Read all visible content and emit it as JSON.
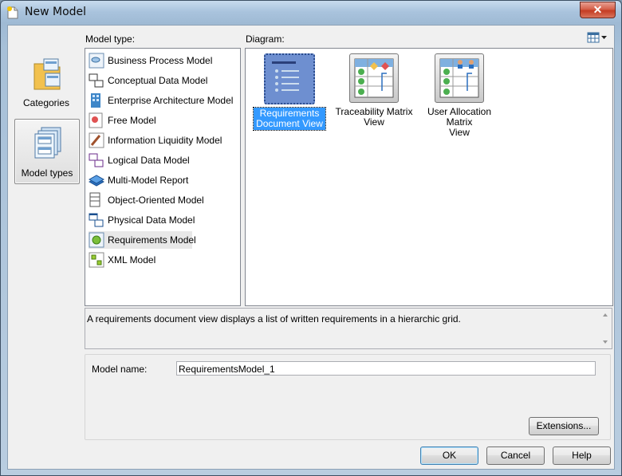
{
  "window": {
    "title": "New Model",
    "close_glyph": "✕"
  },
  "categories": [
    {
      "label": "Categories",
      "icon": "folder-categories-icon",
      "selected": false
    },
    {
      "label": "Model types",
      "icon": "model-types-icon",
      "selected": true
    }
  ],
  "model_type": {
    "heading": "Model type:",
    "items": [
      {
        "label": "Business Process Model",
        "icon": "business-process-model-icon"
      },
      {
        "label": "Conceptual Data Model",
        "icon": "conceptual-data-model-icon"
      },
      {
        "label": "Enterprise Architecture Model",
        "icon": "enterprise-architecture-model-icon"
      },
      {
        "label": "Free Model",
        "icon": "free-model-icon"
      },
      {
        "label": "Information Liquidity Model",
        "icon": "information-liquidity-model-icon"
      },
      {
        "label": "Logical Data Model",
        "icon": "logical-data-model-icon"
      },
      {
        "label": "Multi-Model Report",
        "icon": "multi-model-report-icon"
      },
      {
        "label": "Object-Oriented Model",
        "icon": "object-oriented-model-icon"
      },
      {
        "label": "Physical Data Model",
        "icon": "physical-data-model-icon"
      },
      {
        "label": "Requirements Model",
        "icon": "requirements-model-icon",
        "selected": true
      },
      {
        "label": "XML Model",
        "icon": "xml-model-icon"
      }
    ]
  },
  "diagram": {
    "heading": "Diagram:",
    "items": [
      {
        "line1": "Requirements",
        "line2": "Document View",
        "selected": true
      },
      {
        "line1": "Traceability Matrix",
        "line2": "View",
        "selected": false
      },
      {
        "line1": "User Allocation Matrix",
        "line2": "View",
        "selected": false
      }
    ]
  },
  "description": "A requirements document view displays a list of written requirements in a hierarchic grid.",
  "model_name": {
    "label": "Model name:",
    "value": "RequirementsModel_1"
  },
  "buttons": {
    "extensions": "Extensions...",
    "ok": "OK",
    "cancel": "Cancel",
    "help": "Help"
  }
}
